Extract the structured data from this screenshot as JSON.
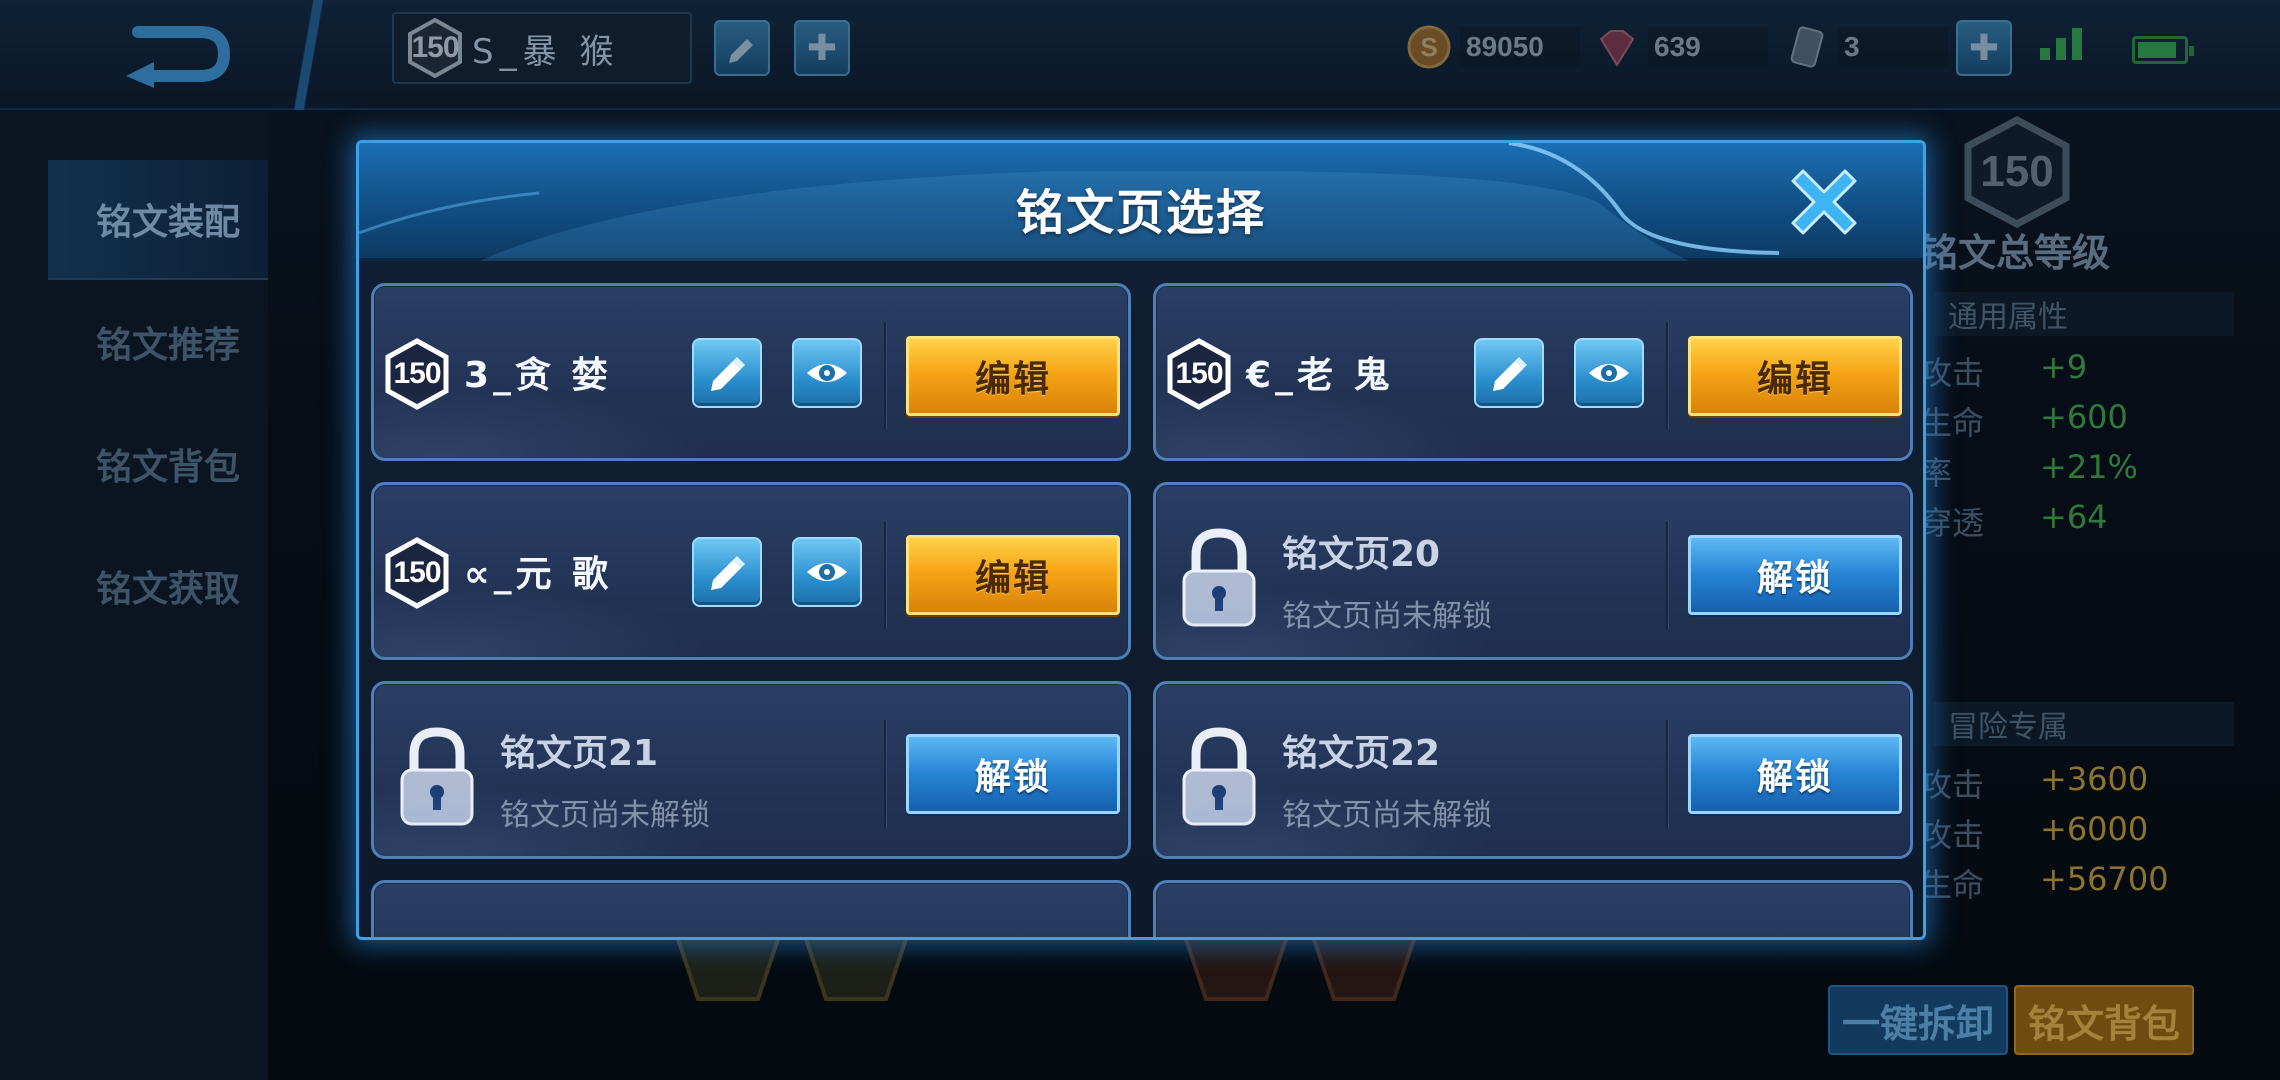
{
  "topbar": {
    "player_level": "150",
    "player_name": "S_暴 猴",
    "currencies": [
      {
        "icon": "gold-coin-icon",
        "value": "89050"
      },
      {
        "icon": "diamond-icon",
        "value": "639"
      },
      {
        "icon": "crystal-icon",
        "value": "3"
      }
    ]
  },
  "left_nav": {
    "items": [
      {
        "label": "铭文装配",
        "active": true
      },
      {
        "label": "铭文推荐",
        "active": false
      },
      {
        "label": "铭文背包",
        "active": false
      },
      {
        "label": "铭文获取",
        "active": false
      }
    ]
  },
  "right_panel": {
    "level": "150",
    "title": "铭文总等级",
    "general_header": "通用属性",
    "general_stats": [
      {
        "key": "攻击",
        "value": "+9"
      },
      {
        "key": "生命",
        "value": "+600"
      },
      {
        "key": "率",
        "value": "+21%"
      },
      {
        "key": "穿透",
        "value": "+64"
      }
    ],
    "adventure_header": "冒险专属",
    "adventure_stats": [
      {
        "key": "攻击",
        "value": "+3600"
      },
      {
        "key": "攻击",
        "value": "+6000"
      },
      {
        "key": "生命",
        "value": "+56700"
      }
    ],
    "btn_unload": "一键拆卸",
    "btn_bag": "铭文背包"
  },
  "modal": {
    "title": "铭文页选择",
    "pages": [
      {
        "level": "150",
        "name": "3_贪 婪",
        "locked": false,
        "button": "编辑"
      },
      {
        "level": "150",
        "name": "€_老 鬼",
        "locked": false,
        "button": "编辑"
      },
      {
        "level": "150",
        "name": "∝_元 歌",
        "locked": false,
        "button": "编辑"
      },
      {
        "name": "铭文页20",
        "subtitle": "铭文页尚未解锁",
        "locked": true,
        "button": "解锁"
      },
      {
        "name": "铭文页21",
        "subtitle": "铭文页尚未解锁",
        "locked": true,
        "button": "解锁"
      },
      {
        "name": "铭文页22",
        "subtitle": "铭文页尚未解锁",
        "locked": true,
        "button": "解锁"
      }
    ]
  },
  "colors": {
    "accent_blue": "#3ea0e6",
    "edit_gold": "#f6a516",
    "unlock_blue": "#2583d4",
    "stat_green": "#39b54a"
  }
}
